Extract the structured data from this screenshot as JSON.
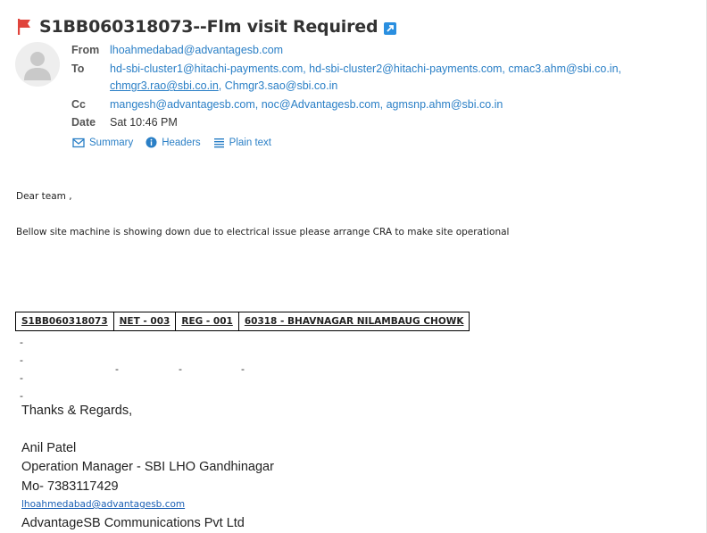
{
  "subject": "S1BB060318073--Flm visit Required",
  "header": {
    "from_label": "From",
    "from_value": "lhoahmedabad@advantagesb.com",
    "to_label": "To",
    "to_line1": "hd-sbi-cluster1@hitachi-payments.com, hd-sbi-cluster2@hitachi-payments.com, cmac3.ahm@sbi.co.in,",
    "to_line2_a": "chmgr3.rao@sbi.co.in",
    "to_line2_b": ", Chmgr3.sao@sbi.co.in",
    "cc_label": "Cc",
    "cc_value": "mangesh@advantagesb.com, noc@Advantagesb.com, agmsnp.ahm@sbi.co.in",
    "date_label": "Date",
    "date_value": "Sat 10:46 PM"
  },
  "view_links": [
    "Summary",
    "Headers",
    "Plain text"
  ],
  "body": {
    "greeting": "Dear team ,",
    "message": "Bellow site machine is showing down due to electrical issue please arrange CRA to make site operational",
    "table": [
      "S1BB060318073",
      "NET - 003",
      "REG - 001",
      "60318 - BHAVNAGAR NILAMBAUG CHOWK"
    ],
    "dash": "-"
  },
  "signature": {
    "closing": "Thanks & Regards,",
    "name": "Anil Patel",
    "title": "Operation Manager - SBI LHO Gandhinagar",
    "phone": "Mo- 7383117429",
    "email": "lhoahmedabad@advantagesb.com",
    "company": "AdvantageSB Communications Pvt Ltd"
  },
  "colors": {
    "accent": "#2a7fc6",
    "flag": "#e0443c"
  }
}
